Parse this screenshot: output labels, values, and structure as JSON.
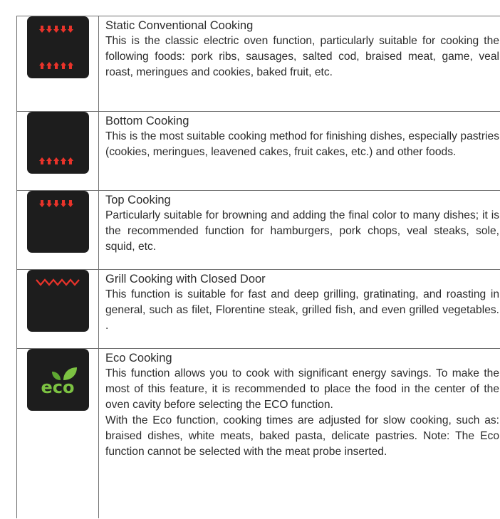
{
  "rows": [
    {
      "title": "Static Conventional Cooking",
      "icon": "top-bottom-heat-icon",
      "paragraphs": [
        "This is the classic electric oven function, particularly suitable for cooking the following foods: pork ribs, sausages, salted cod, braised meat, game, veal roast, meringues and cookies, baked fruit, etc."
      ]
    },
    {
      "title": "Bottom Cooking",
      "icon": "bottom-heat-icon",
      "paragraphs": [
        "This is the most suitable cooking method for finishing dishes, especially pastries (cookies, meringues, leavened cakes, fruit cakes, etc.) and other foods."
      ]
    },
    {
      "title": "Top Cooking",
      "icon": "top-heat-icon",
      "paragraphs": [
        "Particularly suitable for browning and adding the final color to many dishes; it is the recommended function for hamburgers, pork chops, veal steaks, sole, squid, etc."
      ]
    },
    {
      "title": "Grill Cooking with Closed Door",
      "icon": "grill-icon",
      "paragraphs": [
        "This function is suitable for fast and deep grilling, gratinating, and roasting in general, such as filet, Florentine steak, grilled fish, and even grilled vegetables. ."
      ]
    },
    {
      "title": "Eco Cooking",
      "icon": "eco-icon",
      "icon_label": "eco",
      "paragraphs": [
        "This function allows you to cook with significant energy savings. To make the most of this feature, it is recommended to place the food in the center of the oven cavity before selecting the ECO function.",
        "With the Eco function, cooking times are adjusted for slow cooking, such as: braised dishes, white meats, baked pasta, delicate pastries. Note: The Eco function cannot be selected with the meat probe inserted."
      ]
    }
  ],
  "colors": {
    "icon_bg": "#1d1d1d",
    "heat_red": "#e8332a",
    "eco_green": "#7cc242"
  }
}
